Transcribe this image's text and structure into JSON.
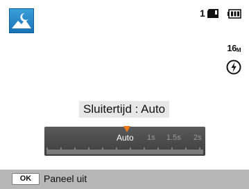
{
  "status": {
    "mode_icon": "landscape-night-scene-icon",
    "shot_count": "1",
    "memory_icon": "memory-card-icon",
    "battery_icon": "battery-full-icon",
    "resolution_value": "16",
    "resolution_unit": "M",
    "flash_icon": "flash-off-icon"
  },
  "shutter": {
    "label": "Sluitertijd : Auto",
    "scale_labels": [
      "Auto",
      "1s",
      "1.5s",
      "2s"
    ],
    "selected": "Auto",
    "marker_color": "#f07a1a"
  },
  "footer": {
    "key_label": "OK",
    "action_label": "Paneel uit"
  }
}
